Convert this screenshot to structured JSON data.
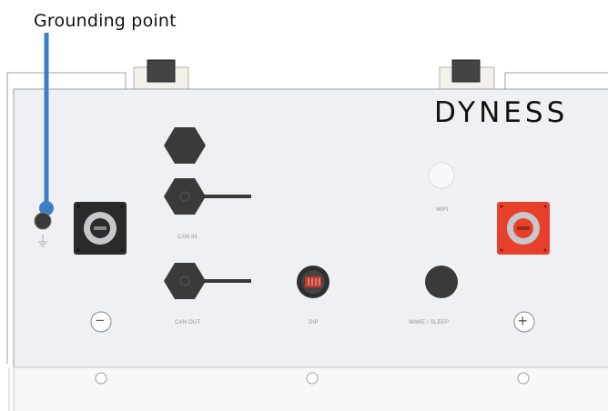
{
  "annotation": {
    "label": "Grounding point"
  },
  "brand": {
    "name": "DYNESS"
  },
  "ports": {
    "can_in": "CAN IN",
    "can_out": "CAN OUT",
    "dip": "DIP",
    "wifi": "WIFI",
    "wake_sleep": "WAKE / SLEEP"
  },
  "terminals": {
    "negative": "−",
    "positive": "+"
  },
  "colors": {
    "panel": "#eef0f3",
    "annotation_line": "#3d7fc4",
    "positive_terminal": "#e8412b",
    "negative_terminal": "#2b2b2b"
  },
  "icons": [
    "ground-symbol-icon",
    "wifi-indicator",
    "screw-icon"
  ]
}
